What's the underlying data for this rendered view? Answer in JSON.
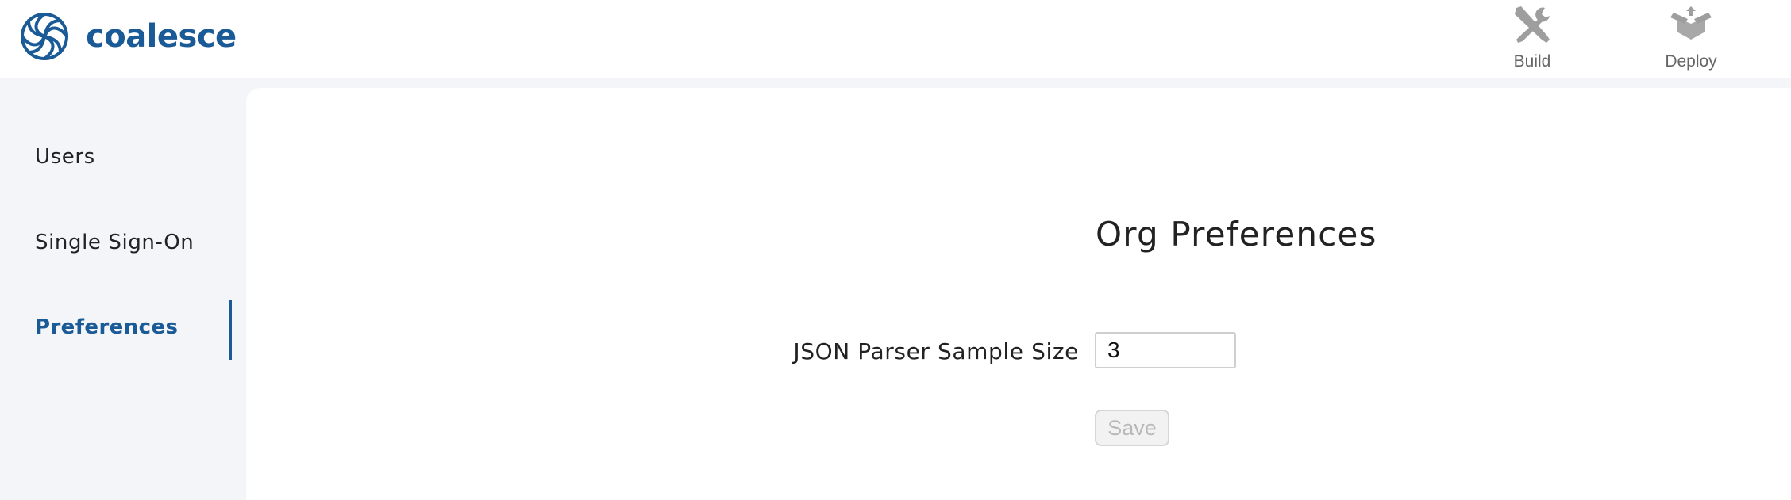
{
  "brand": {
    "name": "coalesce",
    "logo_icon": "coalesce-swirl-icon",
    "color": "#1a5a96"
  },
  "topnav": {
    "build": {
      "label": "Build",
      "icon": "wrench-screwdriver-icon"
    },
    "deploy": {
      "label": "Deploy",
      "icon": "deploy-box-icon"
    }
  },
  "sidebar": {
    "items": [
      {
        "label": "Users",
        "active": false
      },
      {
        "label": "Single Sign-On",
        "active": false
      },
      {
        "label": "Preferences",
        "active": true
      }
    ]
  },
  "main": {
    "title": "Org Preferences",
    "json_parser": {
      "label": "JSON Parser Sample Size",
      "value": "3"
    },
    "save_label": "Save",
    "save_disabled": true
  },
  "colors": {
    "accent": "#1a5a96",
    "muted_icon": "#9e9e9e",
    "sidebar_bg": "#f3f5f9",
    "content_bg": "#ffffff"
  }
}
